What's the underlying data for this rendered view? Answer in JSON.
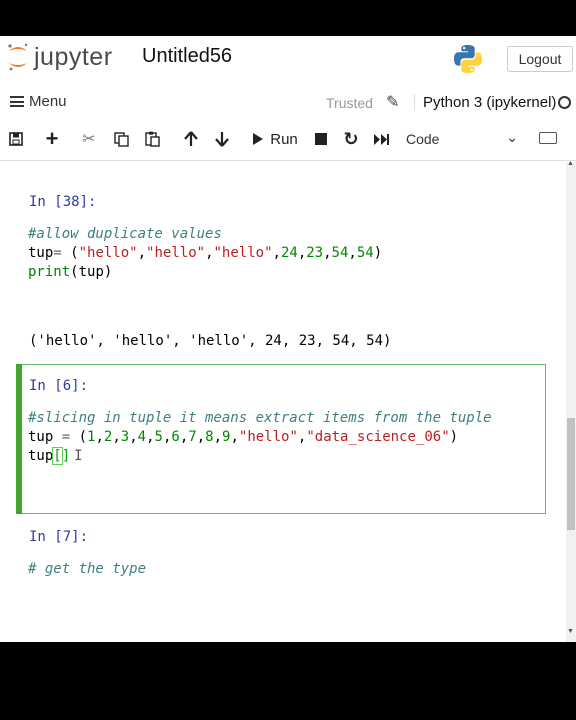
{
  "header": {
    "brand": "jupyter",
    "notebook_title": "Untitled56",
    "logout_label": "Logout"
  },
  "menubar": {
    "menu_label": "Menu",
    "trusted_label": "Trusted",
    "kernel_name": "Python 3 (ipykernel)"
  },
  "toolbar": {
    "run_label": "Run",
    "cell_type": "Code",
    "icons": [
      "save-icon",
      "add-cell-icon",
      "cut-icon",
      "copy-icon",
      "paste-icon",
      "move-up-icon",
      "move-down-icon",
      "run-icon",
      "stop-icon",
      "restart-icon",
      "fast-forward-icon",
      "keyboard-icon"
    ]
  },
  "cells": [
    {
      "prompt": "In [38]:",
      "lines": [
        "#allow duplicate values",
        "tup= (\"hello\",\"hello\",\"hello\",24,23,54,54)",
        "print(tup)"
      ],
      "output": "('hello', 'hello', 'hello', 24, 23, 54, 54)"
    },
    {
      "prompt": "In [6]:",
      "lines": [
        "#slicing in tuple it means extract items from the tuple",
        "tup = (1,2,3,4,5,6,7,8,9,\"hello\",\"data_science_06\")",
        "tup[]"
      ]
    },
    {
      "prompt": "In [7]:",
      "lines": [
        "# get the type"
      ]
    }
  ],
  "colors": {
    "prompt": "#303f9f",
    "comment": "#408080",
    "string": "#ba2121",
    "number": "#008800",
    "active_cell": "#42a52c"
  }
}
